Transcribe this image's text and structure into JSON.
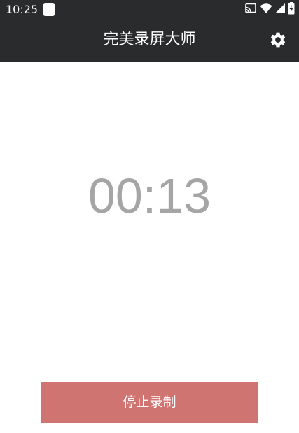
{
  "status_bar": {
    "time": "10:25",
    "icons": [
      "app-notification-icon",
      "cast-icon",
      "wifi-icon",
      "cellular-signal-icon",
      "battery-charging-icon"
    ]
  },
  "toolbar": {
    "title": "完美录屏大师",
    "settings_icon": "gear-icon"
  },
  "timer": {
    "value": "00:13"
  },
  "actions": {
    "stop_label": "停止录制"
  },
  "colors": {
    "toolbar_bg": "#2a2b2d",
    "timer_text": "#a5a5a5",
    "stop_button_bg": "#d07472",
    "background": "#ffffff"
  }
}
